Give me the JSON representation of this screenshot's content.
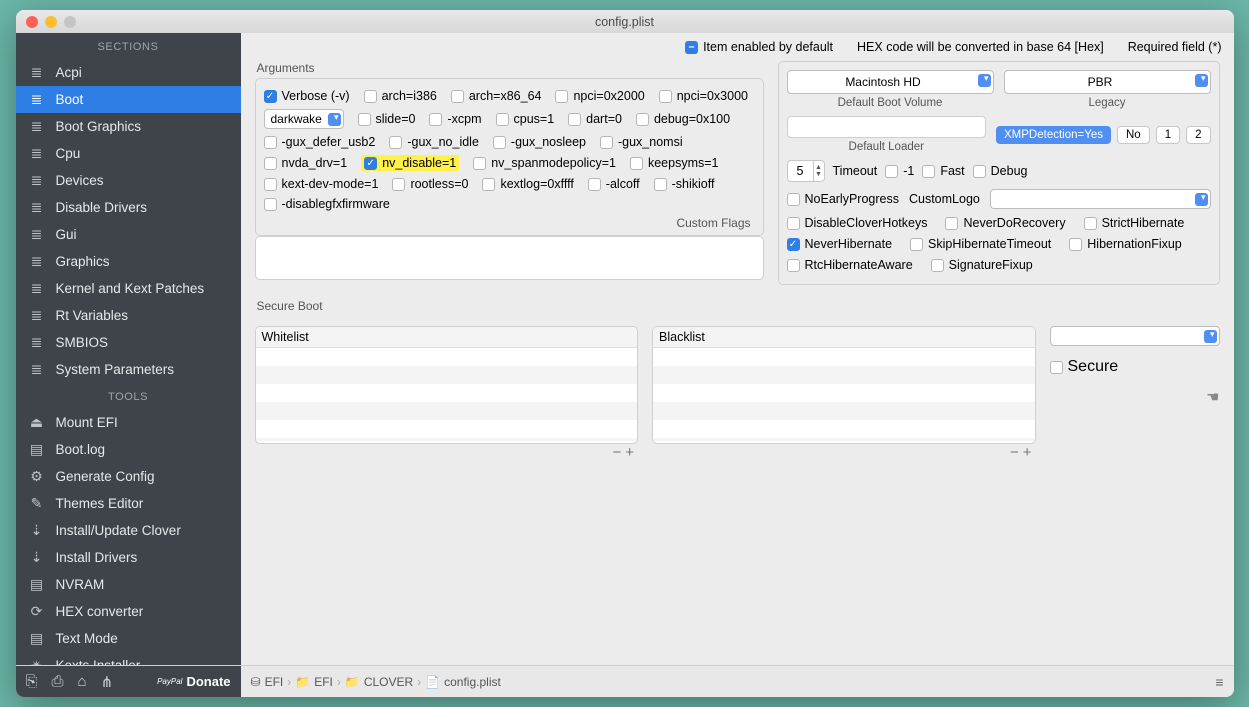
{
  "window": {
    "title": "config.plist"
  },
  "topbar": {
    "item_enabled": "Item enabled by default",
    "hex_note": "HEX code will be converted in base 64 [Hex]",
    "required": "Required field (*)"
  },
  "sidebar": {
    "sections_head": "SECTIONS",
    "tools_head": "TOOLS",
    "sections": [
      {
        "label": "Acpi",
        "icon": "≣"
      },
      {
        "label": "Boot",
        "icon": "≣",
        "selected": true
      },
      {
        "label": "Boot Graphics",
        "icon": "≣"
      },
      {
        "label": "Cpu",
        "icon": "≣"
      },
      {
        "label": "Devices",
        "icon": "≣"
      },
      {
        "label": "Disable Drivers",
        "icon": "≣"
      },
      {
        "label": "Gui",
        "icon": "≣"
      },
      {
        "label": "Graphics",
        "icon": "≣"
      },
      {
        "label": "Kernel and Kext Patches",
        "icon": "≣"
      },
      {
        "label": "Rt Variables",
        "icon": "≣"
      },
      {
        "label": "SMBIOS",
        "icon": "≣"
      },
      {
        "label": "System Parameters",
        "icon": "≣"
      }
    ],
    "tools": [
      {
        "label": "Mount EFI",
        "icon": "⏏"
      },
      {
        "label": "Boot.log",
        "icon": "▤"
      },
      {
        "label": "Generate Config",
        "icon": "⚙"
      },
      {
        "label": "Themes Editor",
        "icon": "✎"
      },
      {
        "label": "Install/Update Clover",
        "icon": "⇣"
      },
      {
        "label": "Install Drivers",
        "icon": "⇣"
      },
      {
        "label": "NVRAM",
        "icon": "▤"
      },
      {
        "label": "HEX converter",
        "icon": "⟳"
      },
      {
        "label": "Text Mode",
        "icon": "▤"
      },
      {
        "label": "Kexts Installer",
        "icon": "✴"
      }
    ]
  },
  "args": {
    "title": "Arguments",
    "row1": [
      {
        "label": "Verbose (-v)",
        "checked": true
      },
      {
        "label": "arch=i386"
      },
      {
        "label": "arch=x86_64"
      },
      {
        "label": "npci=0x2000"
      },
      {
        "label": "npci=0x3000"
      }
    ],
    "darkwake": "darkwake",
    "row2": [
      {
        "label": "slide=0"
      },
      {
        "label": "-xcpm"
      },
      {
        "label": "cpus=1"
      },
      {
        "label": "dart=0"
      },
      {
        "label": "debug=0x100"
      }
    ],
    "row3": [
      {
        "label": "-gux_defer_usb2"
      },
      {
        "label": "-gux_no_idle"
      },
      {
        "label": "-gux_nosleep"
      },
      {
        "label": "-gux_nomsi"
      }
    ],
    "row4": [
      {
        "label": "nvda_drv=1"
      },
      {
        "label": "nv_disable=1",
        "checked": true,
        "hl": true
      },
      {
        "label": "nv_spanmodepolicy=1"
      },
      {
        "label": "keepsyms=1"
      }
    ],
    "row5": [
      {
        "label": "kext-dev-mode=1"
      },
      {
        "label": "rootless=0"
      },
      {
        "label": "kextlog=0xffff"
      },
      {
        "label": "-alcoff"
      },
      {
        "label": "-shikioff"
      }
    ],
    "row6": [
      {
        "label": "-disablegfxfirmware"
      }
    ],
    "custom_flags_label": "Custom Flags"
  },
  "right": {
    "default_boot_volume": "Macintosh HD",
    "default_boot_volume_label": "Default Boot Volume",
    "legacy": "PBR",
    "legacy_label": "Legacy",
    "default_loader_label": "Default Loader",
    "xmp": "XMPDetection=Yes",
    "no": "No",
    "one": "1",
    "two": "2",
    "timeout_value": "5",
    "timeout_label": "Timeout",
    "timeout_checks": [
      {
        "label": "-1"
      },
      {
        "label": "Fast"
      },
      {
        "label": "Debug"
      }
    ],
    "customlogo_label": "CustomLogo",
    "rows": [
      [
        {
          "label": "NoEarlyProgress"
        }
      ],
      [
        {
          "label": "DisableCloverHotkeys"
        },
        {
          "label": "NeverDoRecovery"
        },
        {
          "label": "StrictHibernate"
        }
      ],
      [
        {
          "label": "NeverHibernate",
          "checked": true
        },
        {
          "label": "SkipHibernateTimeout"
        },
        {
          "label": "HibernationFixup"
        }
      ],
      [
        {
          "label": "RtcHibernateAware"
        },
        {
          "label": "SignatureFixup"
        }
      ]
    ]
  },
  "secure": {
    "title": "Secure Boot",
    "whitelist": "Whitelist",
    "blacklist": "Blacklist",
    "secure_chk": "Secure"
  },
  "footer": {
    "donate": "Donate",
    "paypal": "PayPal",
    "bc": [
      "EFI",
      "EFI",
      "CLOVER",
      "config.plist"
    ]
  }
}
